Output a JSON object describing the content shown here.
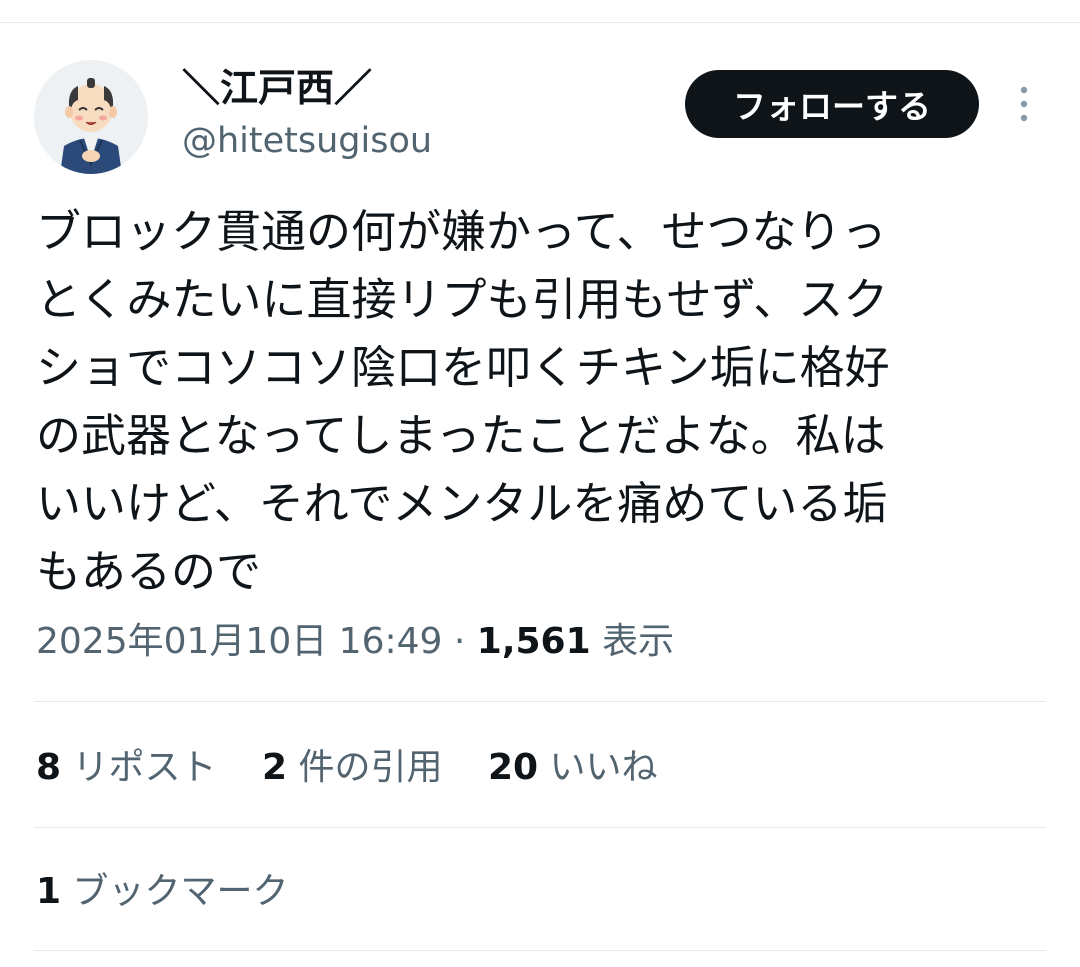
{
  "author": {
    "display_name": "＼江戸西／",
    "handle": "@hitetsugisou",
    "avatar_icon": "samurai-avatar-icon"
  },
  "follow_label": "フォローする",
  "more_icon": "more-vertical-icon",
  "tweet": {
    "lines": [
      "ブロック貫通の何が嫌かって、せつなりっ",
      "とくみたいに直接リプも引用もせず、スク",
      "ショでコソコソ陰口を叩くチキン垢に格好",
      "の武器となってしまったことだよな。私は",
      "いいけど、それでメンタルを痛めている垢",
      "もあるので"
    ]
  },
  "meta": {
    "datetime": "2025年01月10日 16:49",
    "separator": " · ",
    "views_count": "1,561",
    "views_label": " 表示"
  },
  "stats": {
    "reposts_count": "8",
    "reposts_label": " リポスト",
    "quotes_count": "2",
    "quotes_label": " 件の引用",
    "likes_count": "20",
    "likes_label": " いいね"
  },
  "bookmarks": {
    "count": "1",
    "label": " ブックマーク"
  },
  "colors": {
    "text_primary": "#0f1419",
    "text_secondary": "#536471",
    "divider": "#e6e9ec",
    "follow_bg": "#0f1419"
  }
}
